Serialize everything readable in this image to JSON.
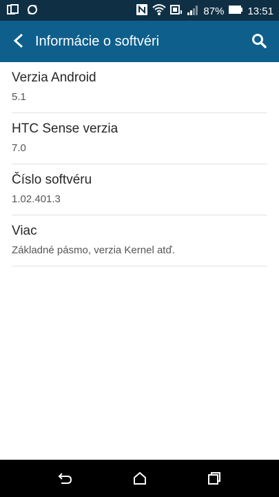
{
  "status_bar": {
    "battery_text": "87%",
    "time": "13:51",
    "icons": [
      "copy-icon",
      "sync-icon",
      "nfc-icon",
      "wifi-icon",
      "sim-icon",
      "signal-icon",
      "battery-icon"
    ]
  },
  "app_bar": {
    "title": "Informácie o softvéri",
    "back_icon": "back-arrow-icon",
    "search_icon": "search-icon"
  },
  "items": [
    {
      "title": "Verzia Android",
      "value": "5.1"
    },
    {
      "title": "HTC Sense verzia",
      "value": "7.0"
    },
    {
      "title": "Číslo softvéru",
      "value": "1.02.401.3"
    },
    {
      "title": "Viac",
      "value": "Základné pásmo, verzia Kernel atď."
    }
  ],
  "nav_bar": {
    "icons": [
      "back-icon",
      "home-icon",
      "recents-icon"
    ]
  },
  "colors": {
    "status_bar": "#0f2f44",
    "app_bar": "#0e5f8c",
    "nav_bar": "#000000",
    "divider": "#e2e2e2"
  }
}
